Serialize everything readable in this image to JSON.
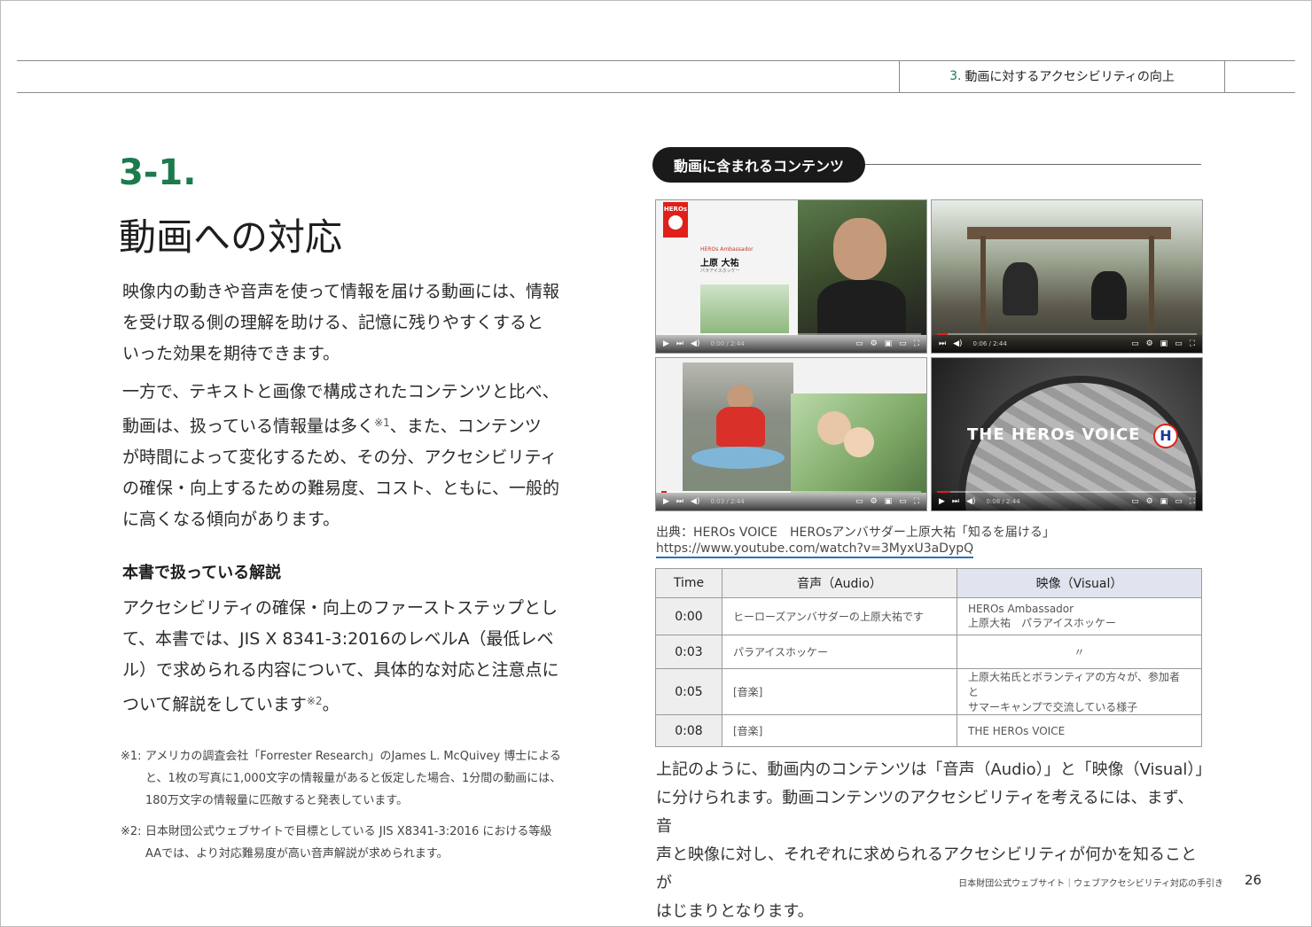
{
  "header": {
    "chapter_num": "3.",
    "chapter_title": "動画に対するアクセシビリティの向上"
  },
  "section": {
    "number": "3-1.",
    "title": "動画への対応"
  },
  "intro_paragraph": [
    "映像内の動きや音声を使って情報を届ける動画には、情報",
    "を受け取る側の理解を助ける、記憶に残りやすくすると",
    "いった効果を期待できます。"
  ],
  "paragraph2": {
    "line1": "一方で、テキストと画像で構成されたコンテンツと比べ、",
    "line2_pre": "動画は、扱っている情報量は多く",
    "line2_note": "※1",
    "line2_post": "、また、コンテンツ",
    "line3": "が時間によって変化するため、その分、アクセシビリティ",
    "line4": "の確保・向上するための難易度、コスト、ともに、一般的",
    "line5": "に高くなる傾向があります。"
  },
  "subheading": "本書で扱っている解説",
  "paragraph3": {
    "line1": "アクセシビリティの確保・向上のファーストステップとし",
    "line2": "て、本書では、JIS X 8341-3:2016のレベルA（最低レベ",
    "line3": "ル）で求められる内容について、具体的な対応と注意点に",
    "line4_pre": "ついて解説をしています",
    "line4_note": "※2",
    "line4_post": "。"
  },
  "footnotes": [
    {
      "mark": "※1:",
      "lines": [
        "アメリカの調査会社「Forrester Research」のJames L. McQuivey 博士による",
        "と、1枚の写真に1,000文字の情報量があると仮定した場合、1分間の動画には、",
        "180万文字の情報量に匹敵すると発表しています。"
      ]
    },
    {
      "mark": "※2:",
      "lines": [
        "日本財団公式ウェブサイトで目標としている JIS X8341-3:2016 における等級",
        "AAでは、より対応難易度が高い音声解説が求められます。"
      ]
    }
  ],
  "figure": {
    "pill_label": "動画に含まれるコンテンツ",
    "thumb1": {
      "logo": "HEROs",
      "ambassador": "HEROs Ambassador",
      "name": "上原 大祐",
      "sub": "パラアイスホッケー",
      "time": "0:00 / 2:44"
    },
    "thumb2": {
      "time": "0:06 / 2:44"
    },
    "thumb3": {
      "time": "0:03 / 2:44"
    },
    "thumb4": {
      "title": "THE HEROs VOICE",
      "time": "0:08 / 2:44"
    },
    "progress": [
      0.0,
      0.04,
      0.02,
      0.05
    ],
    "credit": "出典：HEROs VOICE　HEROsアンバサダー上原大祐「知るを届ける」",
    "url": "https://www.youtube.com/watch?v=3MyxU3aDypQ"
  },
  "table": {
    "headers": [
      "Time",
      "音声（Audio）",
      "映像（Visual）"
    ],
    "rows": [
      {
        "time": "0:00",
        "audio": "ヒーローズアンバサダーの上原大祐です",
        "visual1": "HEROs Ambassador",
        "visual2": "上原大祐　パラアイスホッケー"
      },
      {
        "time": "0:03",
        "audio": "パラアイスホッケー",
        "visual1": "〃",
        "visual2": ""
      },
      {
        "time": "0:05",
        "audio": "[音楽]",
        "visual1": "上原大祐氏とボランティアの方々が、参加者と",
        "visual2": "サマーキャンプで交流している様子"
      },
      {
        "time": "0:08",
        "audio": "[音楽]",
        "visual1": "THE HEROs VOICE",
        "visual2": ""
      }
    ]
  },
  "summary": [
    "上記のように、動画内のコンテンツは「音声（Audio）」と「映像（Visual）」",
    "に分けられます。動画コンテンツのアクセシビリティを考えるには、まず、音",
    "声と映像に対し、それぞれに求められるアクセシビリティが何かを知ることが",
    "はじまりとなります。"
  ],
  "footer": {
    "text": "日本財団公式ウェブサイト｜ウェブアクセシビリティ対応の手引き",
    "page": "26"
  },
  "colors": {
    "accent": "#1c7a4d",
    "link": "#2e6fbf",
    "brand_red": "#e0201a"
  }
}
